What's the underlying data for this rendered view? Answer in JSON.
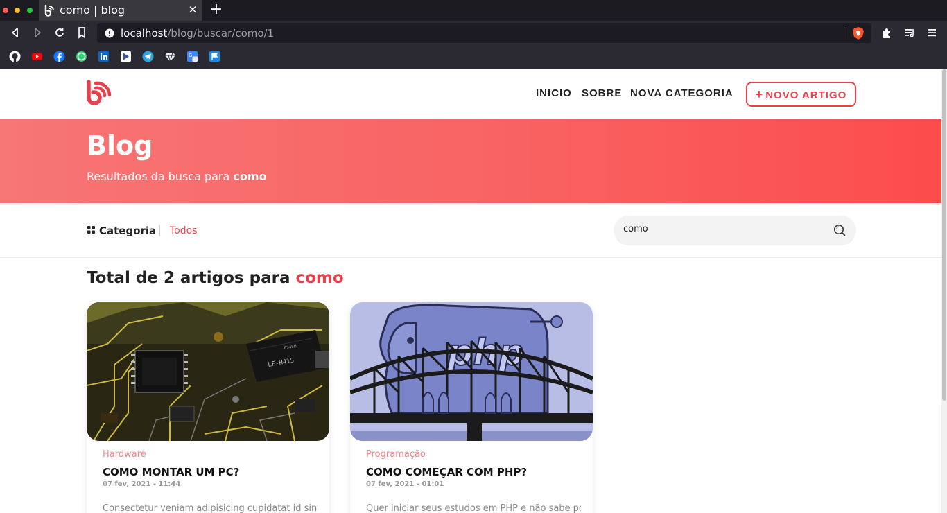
{
  "browser": {
    "tab_title": "como | blog",
    "tab_close": "✕",
    "new_tab": "+",
    "url_host": "localhost",
    "url_path": "/blog/buscar/como/1",
    "bookmarks": [
      "github-icon",
      "youtube-icon",
      "facebook-icon",
      "whatsapp-icon",
      "linkedin-icon",
      "play-icon",
      "telegram-icon",
      "gem-icon",
      "translate-icon",
      "flag-icon"
    ]
  },
  "header": {
    "menu": [
      "INICIO",
      "SOBRE",
      "NOVA CATEGORIA"
    ],
    "cta_plus": "+",
    "cta_label": "NOVO ARTIGO",
    "accent": "#e8414b"
  },
  "hero": {
    "title": "Blog",
    "subtitle_prefix": "Resultados da busca para",
    "subtitle_query": "como"
  },
  "filters": {
    "category_label": "Categoria",
    "category_value": "Todos",
    "search_value": "como"
  },
  "results": {
    "prefix": "Total de 2 artigos para",
    "query": "como"
  },
  "articles": [
    {
      "category": "Hardware",
      "title": "COMO MONTAR UM PC?",
      "date": "07 fev, 2021 - 11:44",
      "excerpt": "Consectetur veniam adipisicing cupidatat id sint"
    },
    {
      "category": "Programação",
      "title": "COMO COMEÇAR COM PHP?",
      "date": "07 fev, 2021 - 01:01",
      "excerpt": "Quer iniciar seus estudos em PHP e não sabe por"
    }
  ]
}
